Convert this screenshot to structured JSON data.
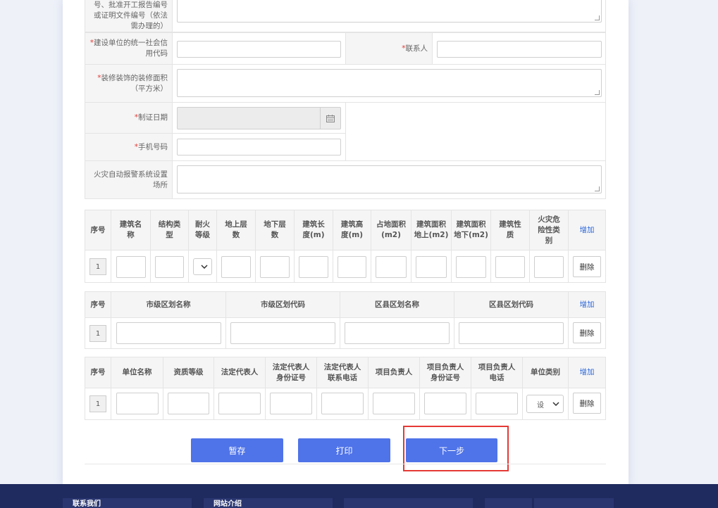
{
  "form": {
    "top_label": "号、批准开工报告编号或证明文件编号（依法需办理的）",
    "credit_code_label": "建设单位的统一社会信用代码",
    "contact_label": "联系人",
    "area_label": "装修装饰的装修面积（平方米）",
    "cert_date_label": "制证日期",
    "phone_label": "手机号码",
    "fire_alarm_label": "火灾自动报警系统设置场所",
    "required_mark": "*"
  },
  "building_table": {
    "headers": [
      "序号",
      "建筑名称",
      "结构类型",
      "耐火等级",
      "地上层数",
      "地下层数",
      "建筑长度(m)",
      "建筑高度(m)",
      "占地面积(m2)",
      "建筑面积地上(m2)",
      "建筑面积地下(m2)",
      "建筑性质",
      "火灾危险性类别"
    ],
    "add_label": "增加",
    "row_index": "1",
    "delete_label": "删除"
  },
  "region_table": {
    "headers": [
      "序号",
      "市级区划名称",
      "市级区划代码",
      "区县区划名称",
      "区县区划代码"
    ],
    "add_label": "增加",
    "row_index": "1",
    "delete_label": "删除"
  },
  "unit_table": {
    "headers": [
      "序号",
      "单位名称",
      "资质等级",
      "法定代表人",
      "法定代表人身份证号",
      "法定代表人联系电话",
      "项目负责人",
      "项目负责人身份证号",
      "项目负责人电话",
      "单位类别"
    ],
    "add_label": "增加",
    "row_index": "1",
    "unit_type_value": "设",
    "delete_label": "删除"
  },
  "actions": {
    "save_label": "暂存",
    "print_label": "打印",
    "next_label": "下一步"
  },
  "footer": {
    "col1": "联系我们",
    "col2": "网站介绍"
  },
  "colors": {
    "primary": "#4f73e8",
    "highlight": "#e53935",
    "footer": "#1f2a5e"
  }
}
